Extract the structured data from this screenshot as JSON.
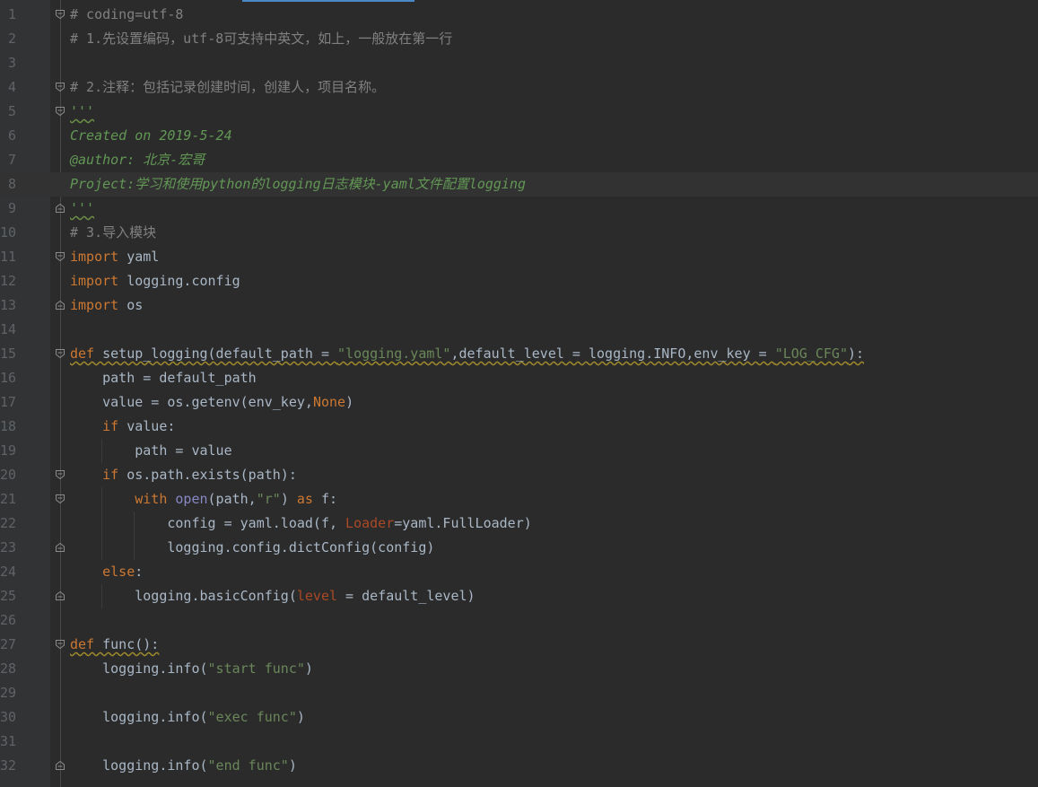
{
  "editor": {
    "language": "python",
    "current_line": 8,
    "lines": [
      {
        "n": "1",
        "text": "# coding=utf-8"
      },
      {
        "n": "2",
        "text": "# 1.先设置编码，utf-8可支持中英文，如上，一般放在第一行"
      },
      {
        "n": "3",
        "text": ""
      },
      {
        "n": "4",
        "text": "# 2.注释：包括记录创建时间，创建人，项目名称。"
      },
      {
        "n": "5",
        "text": "'''"
      },
      {
        "n": "6",
        "text": "Created on 2019-5-24"
      },
      {
        "n": "7",
        "text": "@author: 北京-宏哥"
      },
      {
        "n": "8",
        "text": "Project:学习和使用python的logging日志模块-yaml文件配置logging"
      },
      {
        "n": "9",
        "text": "'''"
      },
      {
        "n": "10",
        "text": "# 3.导入模块"
      },
      {
        "n": "11",
        "text": "import yaml"
      },
      {
        "n": "12",
        "text": "import logging.config"
      },
      {
        "n": "13",
        "text": "import os"
      },
      {
        "n": "14",
        "text": ""
      },
      {
        "n": "15",
        "text": "def setup_logging(default_path = \"logging.yaml\",default_level = logging.INFO,env_key = \"LOG_CFG\"):"
      },
      {
        "n": "16",
        "text": "    path = default_path"
      },
      {
        "n": "17",
        "text": "    value = os.getenv(env_key,None)"
      },
      {
        "n": "18",
        "text": "    if value:"
      },
      {
        "n": "19",
        "text": "        path = value"
      },
      {
        "n": "20",
        "text": "    if os.path.exists(path):"
      },
      {
        "n": "21",
        "text": "        with open(path,\"r\") as f:"
      },
      {
        "n": "22",
        "text": "            config = yaml.load(f, Loader=yaml.FullLoader)"
      },
      {
        "n": "23",
        "text": "            logging.config.dictConfig(config)"
      },
      {
        "n": "24",
        "text": "    else:"
      },
      {
        "n": "25",
        "text": "        logging.basicConfig(level = default_level)"
      },
      {
        "n": "26",
        "text": ""
      },
      {
        "n": "27",
        "text": "def func():"
      },
      {
        "n": "28",
        "text": "    logging.info(\"start func\")"
      },
      {
        "n": "29",
        "text": ""
      },
      {
        "n": "30",
        "text": "    logging.info(\"exec func\")"
      },
      {
        "n": "31",
        "text": ""
      },
      {
        "n": "32",
        "text": "    logging.info(\"end func\")"
      }
    ]
  },
  "colors": {
    "background": "#2b2b2b",
    "gutter": "#313335",
    "line_number": "#606366",
    "current_line": "#323232",
    "keyword": "#cc7832",
    "string": "#6a8759",
    "comment": "#808080",
    "docstring": "#629755",
    "builtin": "#8888c6",
    "parameter": "#aa4926",
    "text": "#a9b7c6"
  },
  "fold_markers": {
    "open": [
      "1",
      "4",
      "5",
      "11",
      "15",
      "20",
      "21",
      "27"
    ],
    "close": [
      "9",
      "13",
      "23",
      "25",
      "32"
    ]
  }
}
